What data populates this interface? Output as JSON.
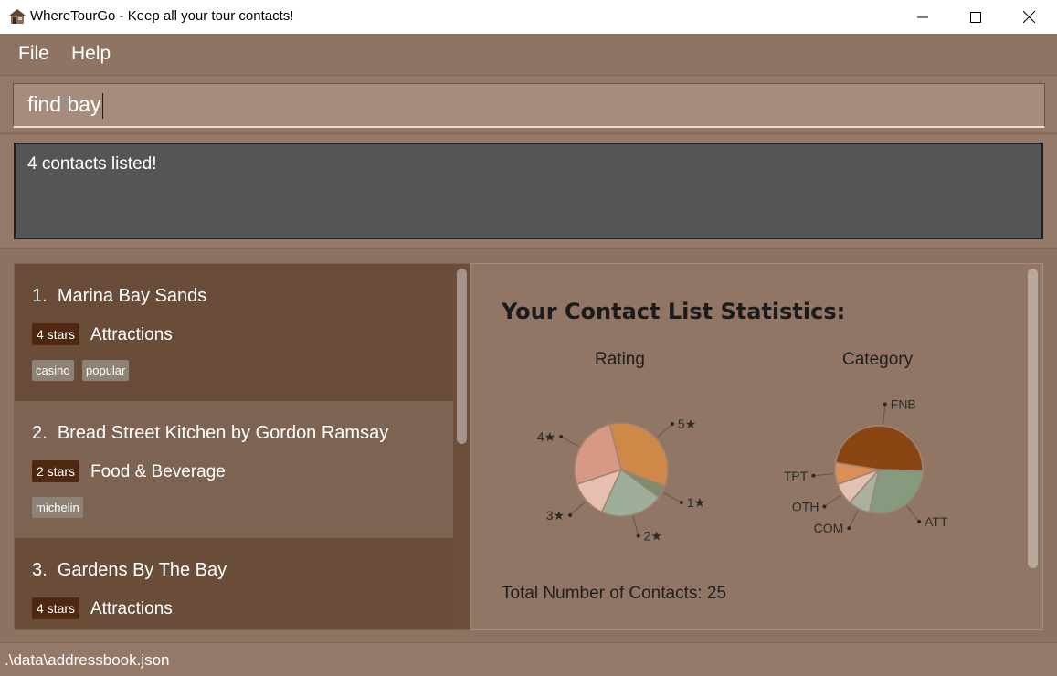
{
  "window": {
    "title": "WhereTourGo - Keep all your tour contacts!",
    "icon": "app-hut-icon",
    "controls": [
      "minimize-icon",
      "maximize-icon",
      "close-icon"
    ]
  },
  "menu": [
    {
      "label": "File"
    },
    {
      "label": "Help"
    }
  ],
  "command": {
    "value": "find bay"
  },
  "result": {
    "message": "4 contacts listed!"
  },
  "contacts": [
    {
      "index": "1.",
      "name": "Marina Bay Sands",
      "rating": "4 stars",
      "category": "Attractions",
      "tags": [
        "casino",
        "popular"
      ]
    },
    {
      "index": "2.",
      "name": "Bread Street Kitchen by Gordon Ramsay",
      "rating": "2 stars",
      "category": "Food & Beverage",
      "tags": [
        "michelin"
      ]
    },
    {
      "index": "3.",
      "name": "Gardens By The Bay",
      "rating": "4 stars",
      "category": "Attractions",
      "tags": []
    }
  ],
  "stats": {
    "title": "Your Contact List Statistics:",
    "total_label": "Total Number of Contacts: 25"
  },
  "chart_data": [
    {
      "type": "pie",
      "title": "Rating",
      "categories": [
        "5★",
        "1★",
        "2★",
        "3★",
        "4★"
      ],
      "values": [
        8,
        1,
        5,
        3,
        6
      ],
      "colors": [
        "#d08848",
        "#7e8b6f",
        "#9fae98",
        "#e6bfaf",
        "#d79984"
      ]
    },
    {
      "type": "pie",
      "title": "Category",
      "categories": [
        "FNB",
        "ATT",
        "COM",
        "OTH",
        "TPT"
      ],
      "values": [
        12,
        7,
        2,
        2,
        2
      ],
      "colors": [
        "#8b4513",
        "#859a7f",
        "#a9b29f",
        "#e2c1b3",
        "#d98f56"
      ]
    }
  ],
  "status": {
    "path": ".\\data\\addressbook.json"
  }
}
